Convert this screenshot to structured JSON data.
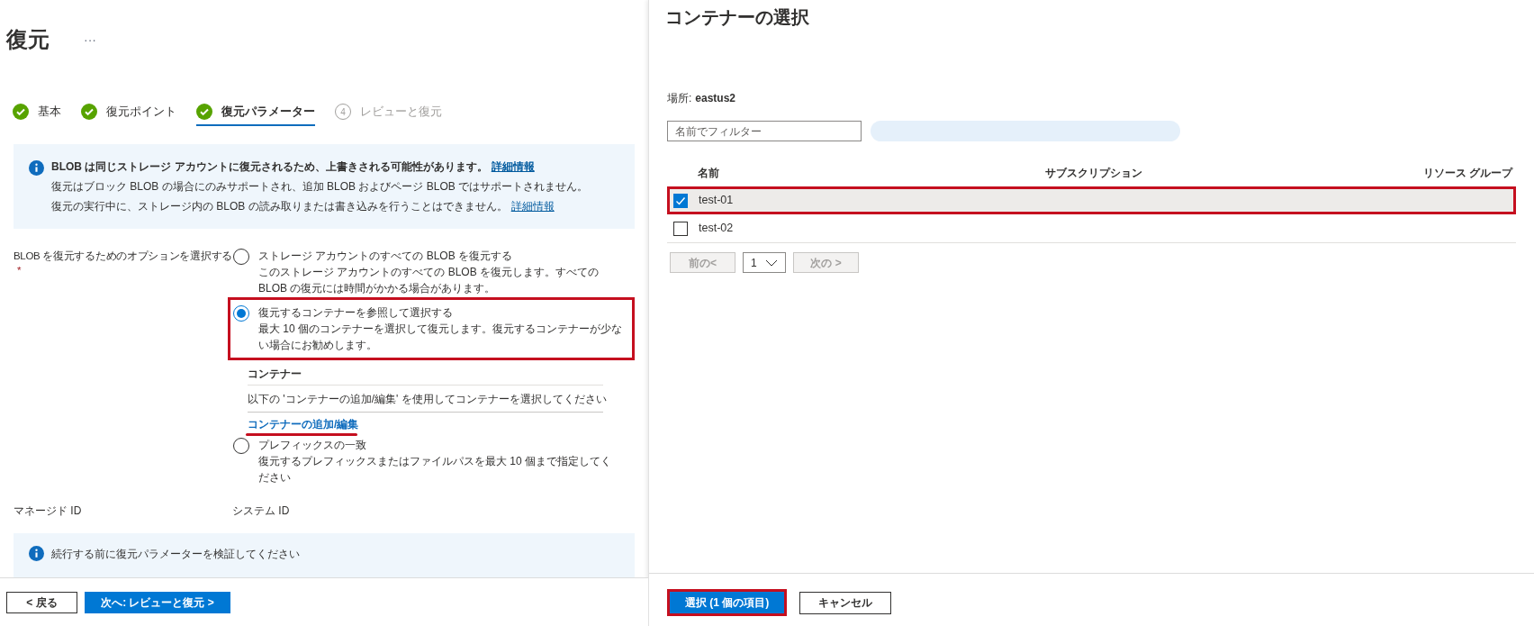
{
  "title": "復元",
  "more_button": "···",
  "steps": [
    {
      "label": "基本",
      "completed": true,
      "selected": false
    },
    {
      "label": "復元ポイント",
      "completed": true,
      "selected": false
    },
    {
      "label": "復元パラメーター",
      "completed": true,
      "selected": true
    },
    {
      "label": "レビューと復元",
      "number": "4",
      "completed": false,
      "selected": false
    }
  ],
  "info_banner": {
    "lines": [
      {
        "text": "BLOB は同じストレージ アカウントに復元されるため、上書きされる可能性があります。",
        "bold": true,
        "link": "詳細情報"
      },
      {
        "text": "復元はブロック BLOB の場合にのみサポートされ、追加 BLOB およびページ BLOB ではサポートされません。",
        "bold": false
      },
      {
        "text": "復元の実行中に、ストレージ内の BLOB の読み取りまたは書き込みを行うことはできません。",
        "bold": false,
        "link": "詳細情報"
      }
    ]
  },
  "restore_option": {
    "label": "BLOB を復元するためのオプションを選択する",
    "required_marker": "*",
    "options": [
      {
        "title": "ストレージ アカウントのすべての BLOB を復元する",
        "description": "このストレージ アカウントのすべての BLOB を復元します。すべての BLOB の復元には時間がかかる場合があります。",
        "selected": false,
        "highlighted": false
      },
      {
        "title": "復元するコンテナーを参照して選択する",
        "description": "最大 10 個のコンテナーを選択して復元します。復元するコンテナーが少ない場合にお勧めします。",
        "selected": true,
        "highlighted": true
      },
      {
        "title": "プレフィックスの一致",
        "description": "復元するプレフィックスまたはファイルパスを最大 10 個まで指定してください",
        "selected": false,
        "highlighted": false
      }
    ]
  },
  "containers_section": {
    "heading": "コンテナー",
    "hint": "以下の 'コンテナーの追加/編集' を使用してコンテナーを選択してください",
    "link": "コンテナーの追加/編集",
    "link_underlined": true
  },
  "managed_id": {
    "label": "マネージド ID",
    "value": "システム ID"
  },
  "validation_banner": "続行する前に復元パラメーターを検証してください",
  "footer_buttons": [
    {
      "label": "< 戻る",
      "kind": "secondary"
    },
    {
      "label": "次へ: レビューと復元 >",
      "kind": "primary"
    }
  ],
  "panel": {
    "title": "コンテナーの選択",
    "location_label": "場所:",
    "location": "eastus2",
    "filter_placeholder": "名前でフィルター",
    "columns": [
      "名前",
      "サブスクリプション",
      "リソース グループ"
    ],
    "rows": [
      {
        "name": "test-01",
        "checked": true,
        "highlighted": true
      },
      {
        "name": "test-02",
        "checked": false,
        "highlighted": false
      }
    ],
    "pager": {
      "prev": {
        "label": "前の<",
        "disabled": true
      },
      "page": "1",
      "next": {
        "label": "次の >",
        "disabled": true
      }
    },
    "buttons": [
      {
        "label": "選択 (1 個の項目)",
        "kind": "primary",
        "highlighted": true
      },
      {
        "label": "キャンセル",
        "kind": "secondary",
        "highlighted": false
      }
    ]
  }
}
